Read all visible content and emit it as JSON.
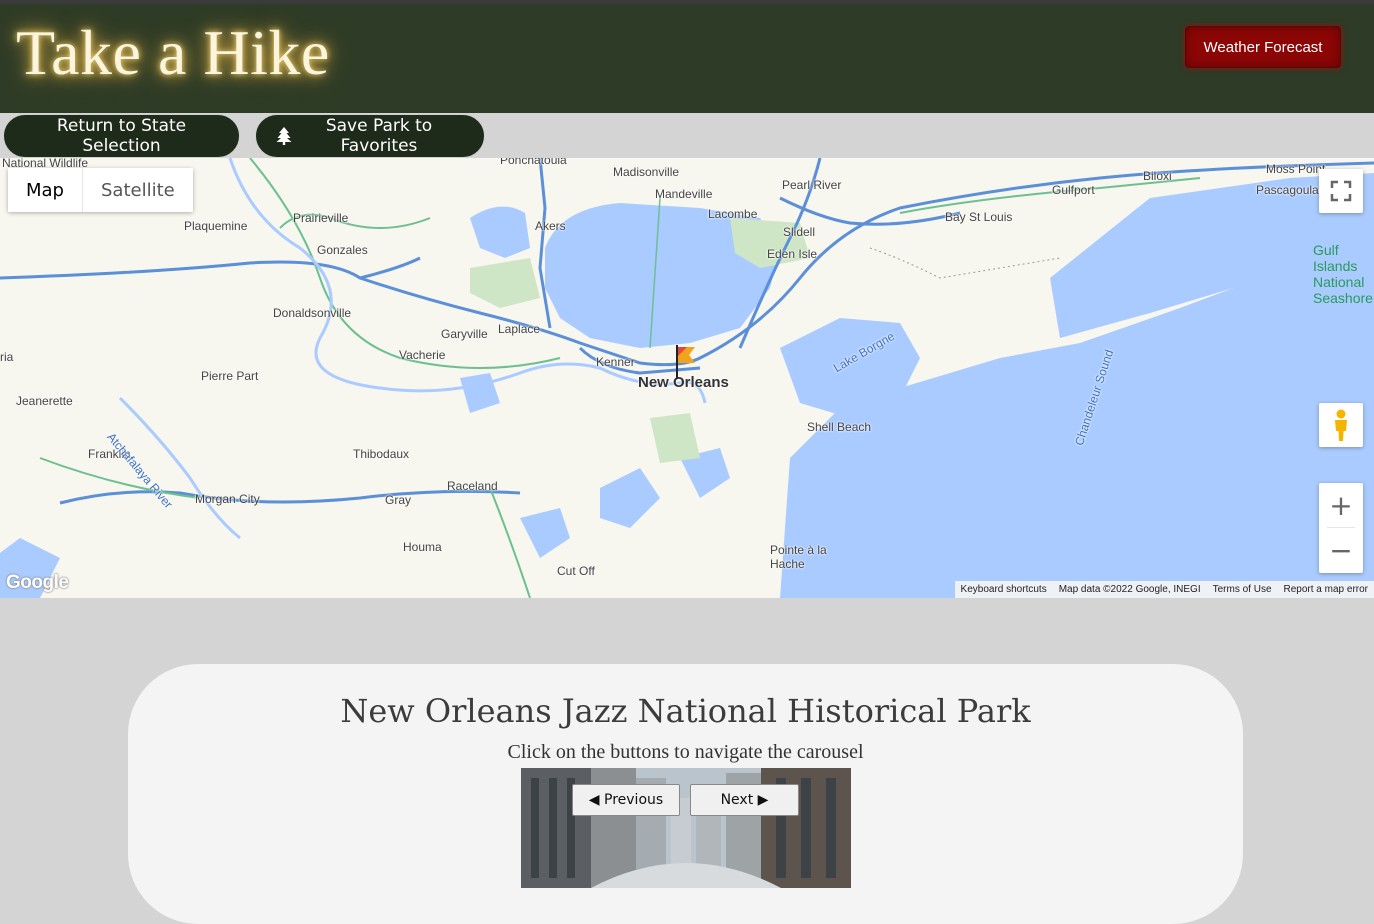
{
  "header": {
    "title": "Take a Hike",
    "weather_button": "Weather Forecast"
  },
  "nav": {
    "return_label": "Return to State Selection",
    "save_label": "Save Park to Favorites"
  },
  "map": {
    "type_buttons": [
      "Map",
      "Satellite"
    ],
    "active_type": "Map",
    "labels": {
      "ponchatoula": "Ponchatoula",
      "madisonville": "Madisonville",
      "mandeville": "Mandeville",
      "pearl_river": "Pearl River",
      "lacombe": "Lacombe",
      "slidell": "Slidell",
      "eden_isle": "Eden Isle",
      "moss_point": "Moss Point",
      "pascagoula": "Pascagoula",
      "biloxi": "Biloxi",
      "gulfport": "Gulfport",
      "bay_st_louis": "Bay St Louis",
      "gulf_islands": "Gulf Islands National Seashore",
      "prairieville": "Prairieville",
      "plaquemine": "Plaquemine",
      "gonzales": "Gonzales",
      "akers": "Akers",
      "donaldsonville": "Donaldsonville",
      "garyville": "Garyville",
      "laplace": "Laplace",
      "vacherie": "Vacherie",
      "kenner": "Kenner",
      "new_orleans": "New Orleans",
      "pierre_part": "Pierre Part",
      "jeanerette": "Jeanerette",
      "franklin": "Franklin",
      "atchafalaya": "Atchafalaya River",
      "morgan_city": "Morgan City",
      "gray": "Gray",
      "thibodaux": "Thibodaux",
      "raceland": "Raceland",
      "houma": "Houma",
      "cut_off": "Cut Off",
      "shell_beach": "Shell Beach",
      "lake_borgne": "Lake Borgne",
      "chandeleur": "Chandeleur Sound",
      "pointe_a_la_hache": "Pointe à la Hache",
      "national_wildlife": "National Wildlife",
      "ria": "ria"
    },
    "google": "Google",
    "attribution": [
      "Keyboard shortcuts",
      "Map data ©2022 Google, INEGI",
      "Terms of Use",
      "Report a map error"
    ]
  },
  "card": {
    "park_name": "New Orleans Jazz National Historical Park",
    "hint": "Click on the buttons to navigate the carousel",
    "prev_label": "◀ Previous",
    "next_label": "Next ▶"
  },
  "colors": {
    "header_bg": "#2e3b26",
    "nav_btn_bg": "#1e2a1a",
    "weather_btn_bg": "#8c0606",
    "water": "#aacbff",
    "card_bg": "#f4f4f4"
  }
}
